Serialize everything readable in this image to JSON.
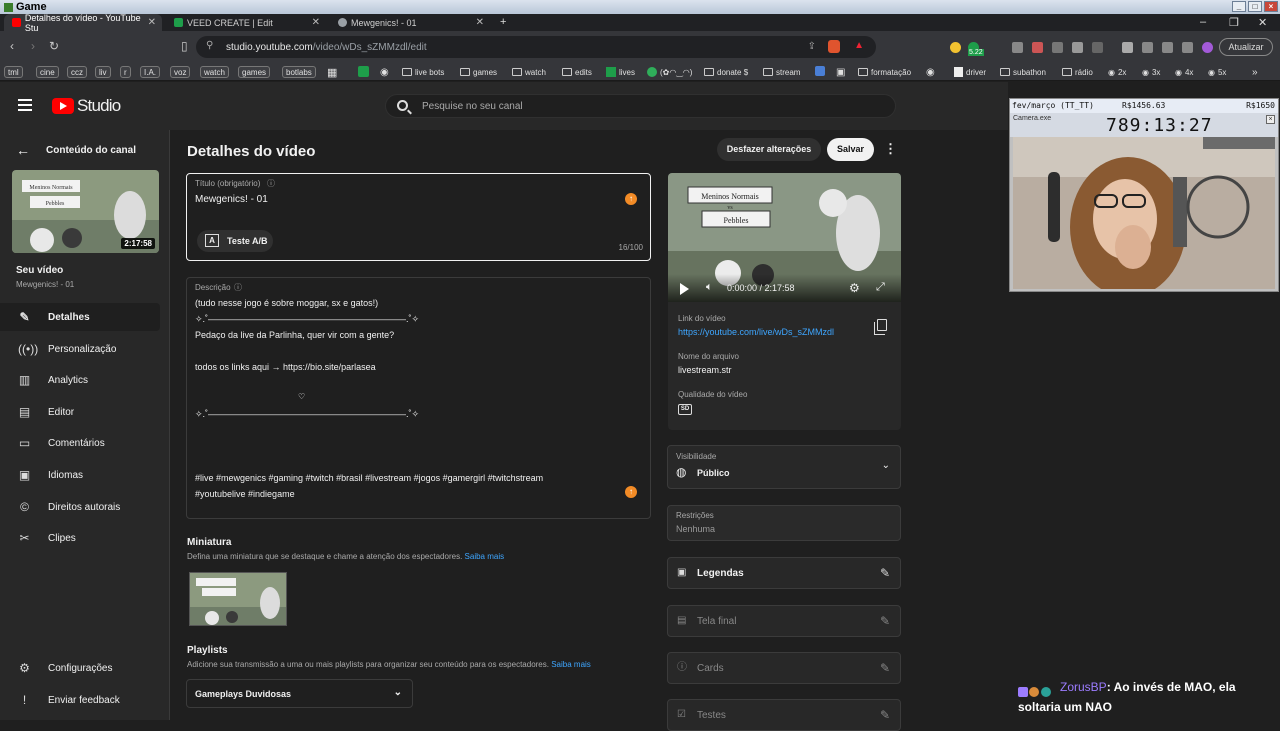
{
  "os": {
    "title": "Game"
  },
  "browser": {
    "tabs": [
      {
        "label": "Detalhes do vídeo - YouTube Stu",
        "active": true,
        "color": "#ff0000"
      },
      {
        "label": "VEED CREATE | Edit",
        "active": false,
        "color": "#1e9e4a"
      },
      {
        "label": "Mewgenics! - 01",
        "active": false,
        "color": "#9aa0a6"
      }
    ],
    "url_host": "studio.youtube.com",
    "url_path": "/video/wDs_sZMMzdl/edit",
    "ext_badge": "5.22",
    "update_label": "Atualizar",
    "bookmarks": [
      "tml",
      "cine",
      "ccz",
      "liv",
      "r",
      "I.A.",
      "voz",
      "watch",
      "games",
      "botlabs",
      "live bots",
      "games",
      "watch",
      "edits",
      "lives",
      "(✿◠‿◠)",
      "donate $",
      "stream",
      "formatação",
      "driver",
      "subathon",
      "rádio",
      "2x",
      "3x",
      "4x",
      "5x"
    ]
  },
  "studio": {
    "logo_text": "Studio",
    "search_placeholder": "Pesquise no seu canal",
    "back_label": "Conteúdo do canal",
    "thumb_duration": "2:17:58",
    "your_video_label": "Seu vídeo",
    "your_video_title": "Mewgenics! - 01",
    "nav": [
      {
        "label": "Detalhes",
        "icon": "pencil-icon",
        "active": true
      },
      {
        "label": "Personalização",
        "icon": "broadcast-icon",
        "active": false
      },
      {
        "label": "Analytics",
        "icon": "analytics-icon",
        "active": false
      },
      {
        "label": "Editor",
        "icon": "editor-icon",
        "active": false
      },
      {
        "label": "Comentários",
        "icon": "comment-icon",
        "active": false
      },
      {
        "label": "Idiomas",
        "icon": "subtitles-icon",
        "active": false
      },
      {
        "label": "Direitos autorais",
        "icon": "copyright-icon",
        "active": false
      },
      {
        "label": "Clipes",
        "icon": "scissors-icon",
        "active": false
      }
    ],
    "settings_label": "Configurações",
    "feedback_label": "Enviar feedback"
  },
  "details": {
    "page_title": "Detalhes do vídeo",
    "undo_label": "Desfazer alterações",
    "save_label": "Salvar",
    "title_label": "Título (obrigatório)",
    "title_value": "Mewgenics! - 01",
    "ab_label": "Teste A/B",
    "char_count": "16/100",
    "description_label": "Descrição",
    "description_lines": [
      "(tudo nesse jogo é sobre moggar, sx e gatos!)",
      "✧.˚——————————————————————.˚✧",
      "Pedaço da live da Parlinha, quer vir com a gente?",
      "todos os links aqui → https://bio.site/parlasea",
      "♡",
      "✧.˚——————————————————————.˚✧",
      "#live #mewgenics #gaming #twitch #brasil #livestream #jogos #gamergirl #twitchstream",
      "#youtubelive #indiegame"
    ],
    "thumbnail_title": "Miniatura",
    "thumbnail_help": "Defina uma miniatura que se destaque e chame a atenção dos espectadores.",
    "learn_more": "Saiba mais",
    "playlists_title": "Playlists",
    "playlists_help": "Adicione sua transmissão a uma ou mais playlists para organizar seu conteúdo para os espectadores.",
    "playlist_value": "Gameplays Duvidosas"
  },
  "right_panel": {
    "player_time": "0:00:00 / 2:17:58",
    "thumb_line1": "Meninos Normais",
    "thumb_line2": "vs",
    "thumb_line3": "Pebbles",
    "link_label": "Link do vídeo",
    "link_value": "https://youtube.com/live/wDs_sZMMzdl",
    "filename_label": "Nome do arquivo",
    "filename_value": "livestream.str",
    "quality_label": "Qualidade do vídeo",
    "quality_badge": "SD",
    "visibility_label": "Visibilidade",
    "visibility_value": "Público",
    "restrictions_label": "Restrições",
    "restrictions_value": "Nenhuma",
    "captions_label": "Legendas",
    "endscreen_label": "Tela final",
    "cards_label": "Cards",
    "tests_label": "Testes"
  },
  "stream_overlay": {
    "goal_label": "fev/março (TT_TT)",
    "goal_current": "R$1456.63",
    "goal_target": "R$1650",
    "window_name": "Camera.exe",
    "timer": "789:13:27",
    "chat_user": "ZorusBP",
    "chat_message": ": Ao invés de MAO, ela soltaria um NAO"
  },
  "colors": {
    "accent_blue": "#3ea6ff",
    "youtube_red": "#ff0000",
    "warning_orange": "#f28b26",
    "chat_user": "#9c7cff"
  }
}
